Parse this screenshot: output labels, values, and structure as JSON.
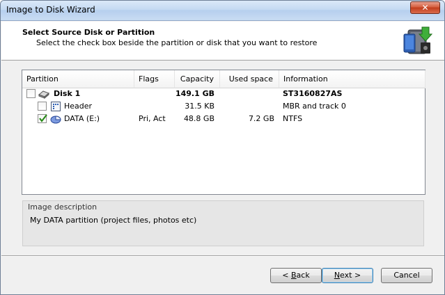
{
  "window": {
    "title": "Image to Disk Wizard",
    "close_glyph": "✕"
  },
  "header": {
    "title": "Select Source Disk or Partition",
    "subtitle": "Select the check box beside the partition or disk that you want to restore",
    "icon": "disk-restore-icon"
  },
  "table": {
    "columns": [
      "Partition",
      "Flags",
      "Capacity",
      "Used space",
      "Information"
    ],
    "rows": [
      {
        "name": "Disk 1",
        "flags": "",
        "capacity": "149.1 GB",
        "used": "",
        "info": "ST3160827AS",
        "checked": false,
        "bold": true,
        "icon": "hard-disk-icon"
      },
      {
        "name": "Header",
        "flags": "",
        "capacity": "31.5 KB",
        "used": "",
        "info": "MBR and track 0",
        "checked": false,
        "bold": false,
        "icon": "header-grid-icon"
      },
      {
        "name": "DATA (E:)",
        "flags": "Pri, Act",
        "capacity": "48.8 GB",
        "used": "7.2 GB",
        "info": "NTFS",
        "checked": true,
        "bold": false,
        "icon": "partition-pie-icon"
      }
    ]
  },
  "description": {
    "label": "Image description",
    "value": "My DATA partition (project files, photos etc)"
  },
  "buttons": {
    "back_prefix": "< ",
    "back_underlined": "B",
    "back_rest": "ack",
    "next_underlined": "N",
    "next_rest": "ext >",
    "cancel": "Cancel"
  }
}
